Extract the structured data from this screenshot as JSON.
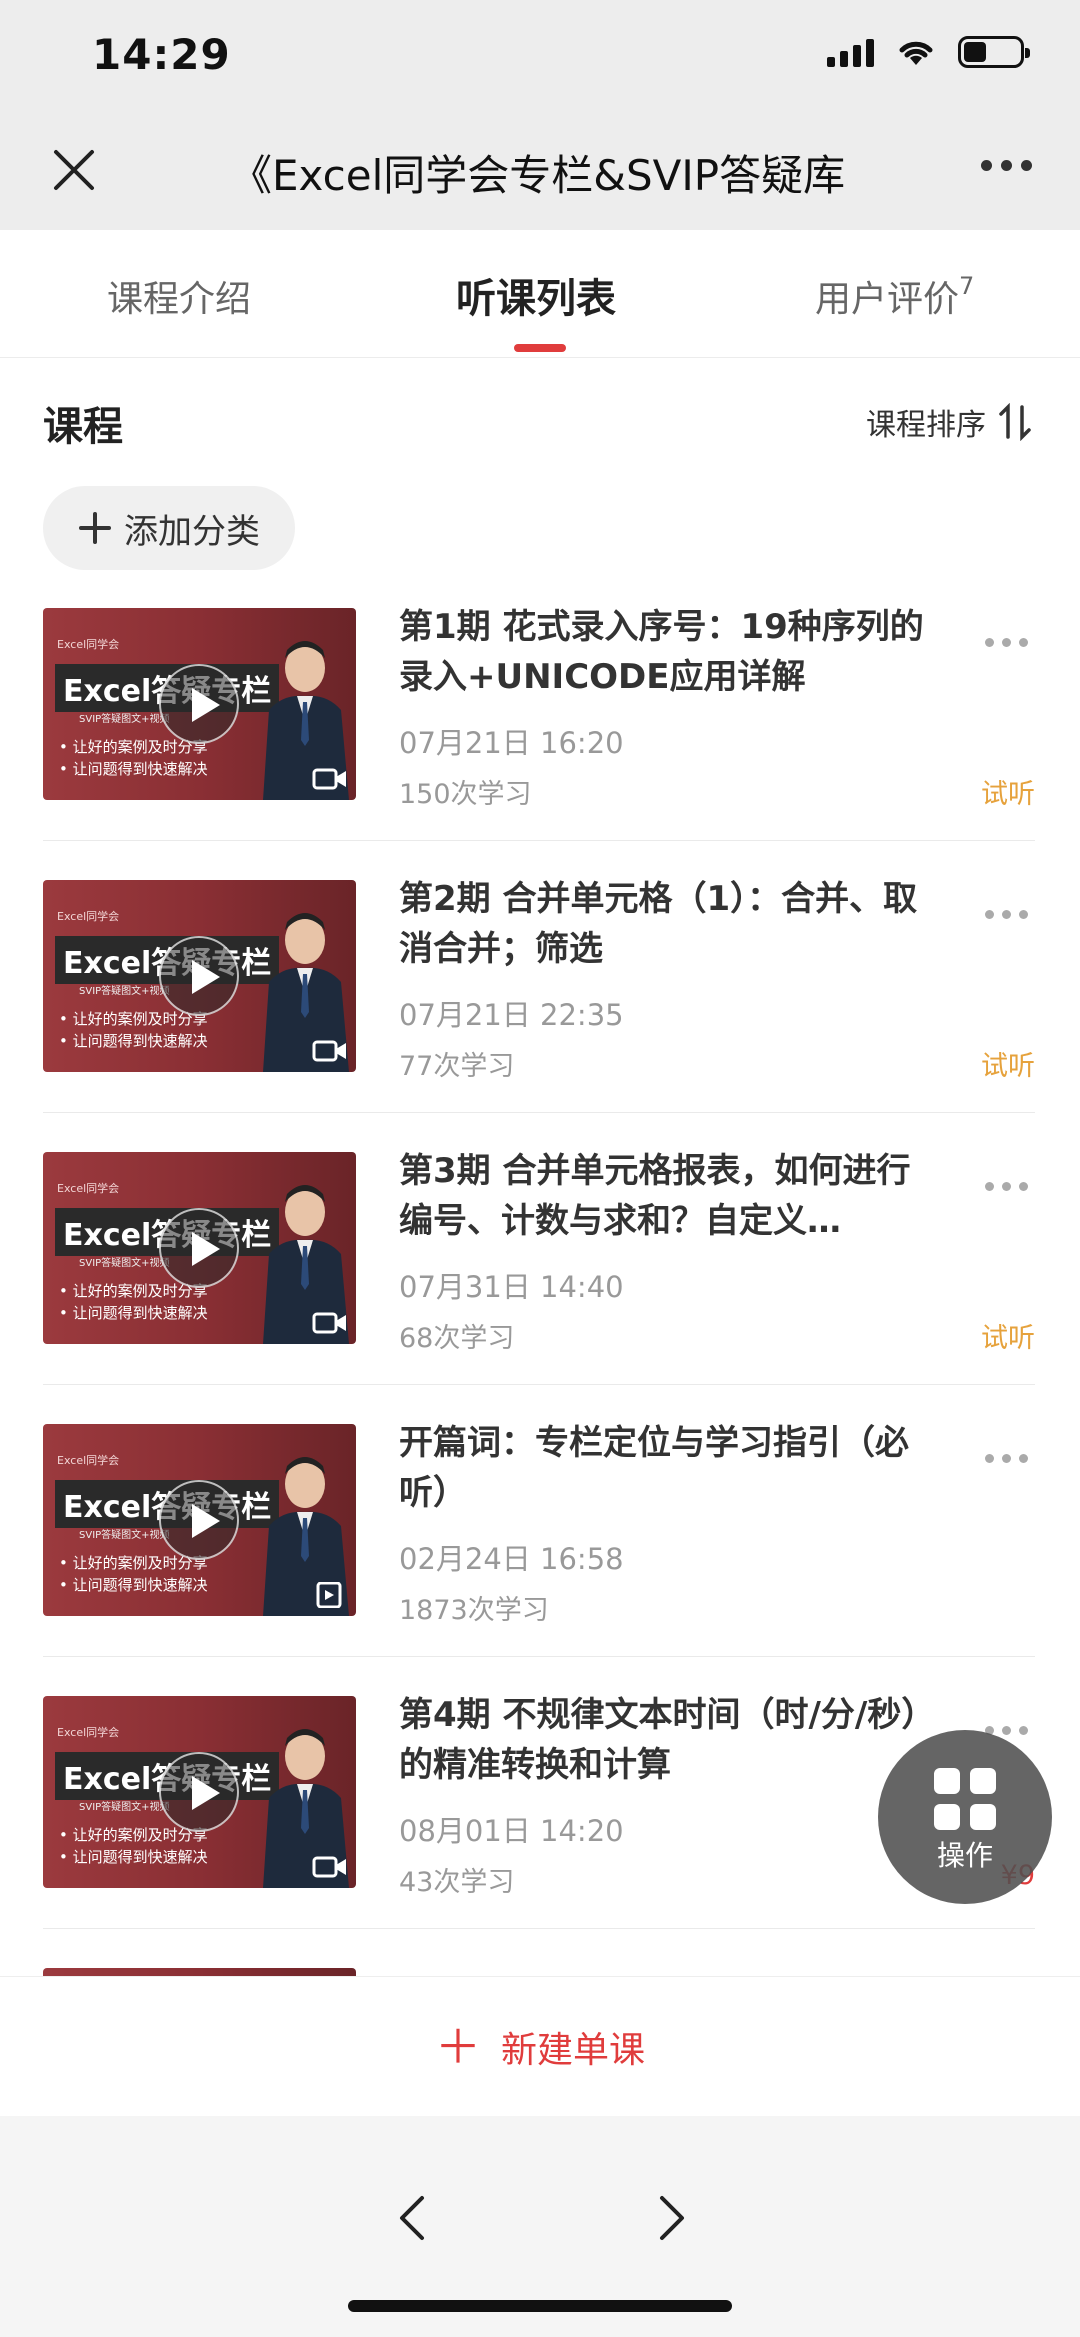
{
  "status_bar": {
    "time": "14:29"
  },
  "nav": {
    "title": "《Excel同学会专栏&SVIP答疑库"
  },
  "tabs": [
    {
      "label": "课程介绍"
    },
    {
      "label": "听课列表"
    },
    {
      "label": "用户评价",
      "badge": "7"
    }
  ],
  "course_section": {
    "title": "课程",
    "sort_label": "课程排序",
    "add_category": "添加分类"
  },
  "thumbnail": {
    "brand": "Excel同学会",
    "banner": "Excel答疑专栏",
    "subtitle": "SVIP答疑图文+视频",
    "bullet1": "• 让好的案例及时分享",
    "bullet2": "• 让问题得到快速解决"
  },
  "lessons": [
    {
      "title": "第1期 花式录入序号：19种序列的录入+UNICODE应用详解",
      "date": "07月21日 16:20",
      "count": "150次学习",
      "tag": "试听",
      "media": "video"
    },
    {
      "title": "第2期 合并单元格（1）：合并、取消合并；筛选",
      "date": "07月21日 22:35",
      "count": "77次学习",
      "tag": "试听",
      "media": "video"
    },
    {
      "title": "第3期 合并单元格报表，如何进行编号、计数与求和？自定义…",
      "date": "07月31日 14:40",
      "count": "68次学习",
      "tag": "试听",
      "media": "video"
    },
    {
      "title": "开篇词：专栏定位与学习指引（必听）",
      "date": "02月24日 16:58",
      "count": "1873次学习",
      "tag": "",
      "media": "article"
    },
    {
      "title": "第4期 不规律文本时间（时/分/秒）的精准转换和计算",
      "date": "08月01日 14:20",
      "count": "43次学习",
      "price": "¥9",
      "media": "video"
    }
  ],
  "new_lesson": {
    "label": "新建单课"
  },
  "fab": {
    "label": "操作"
  },
  "colors": {
    "accent": "#e03c3c",
    "trial": "#e6a23c"
  }
}
